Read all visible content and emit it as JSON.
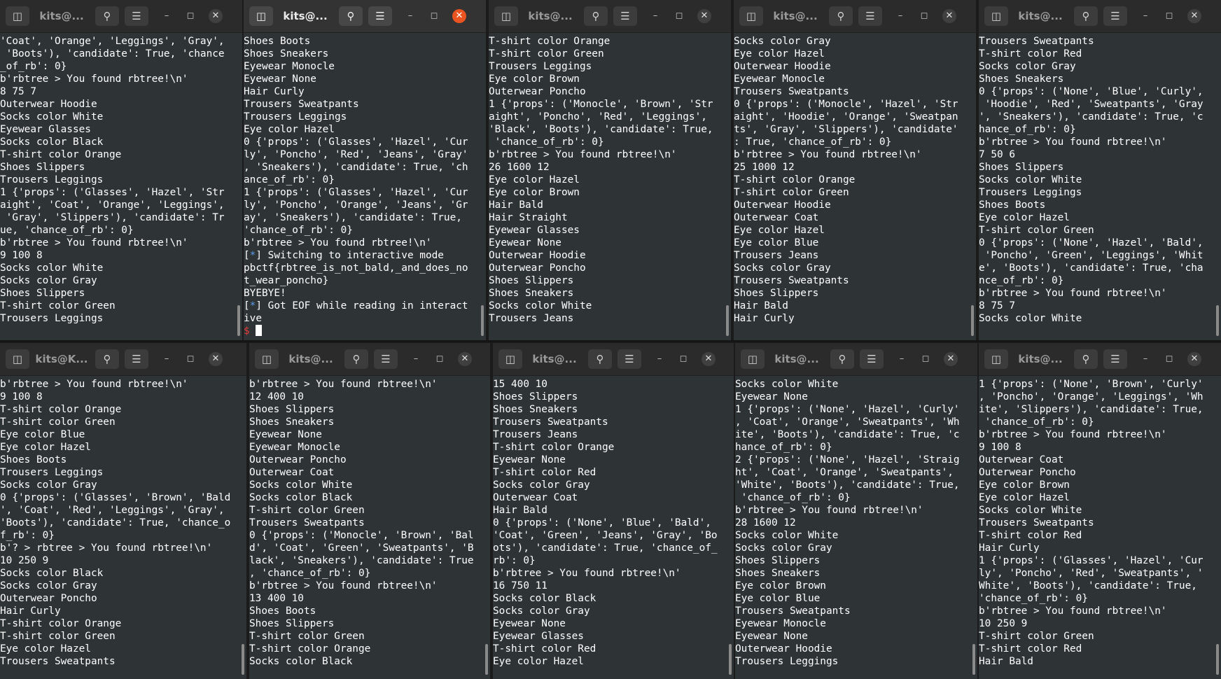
{
  "icons": {
    "new_tab": "new-tab-icon",
    "search": "search-icon",
    "menu": "hamburger-menu-icon",
    "minimize": "minimize-icon",
    "maximize": "maximize-icon",
    "close": "close-icon"
  },
  "colors": {
    "terminal_bg": "#2e3436",
    "close_active": "#e95420",
    "prompt_blue": "#5c9ae6",
    "prompt_red": "#e33b3b"
  },
  "windows": [
    {
      "title": "kits@...",
      "lines": [
        "'Coat', 'Orange', 'Leggings', 'Gray',",
        " 'Boots'), 'candidate': True, 'chance",
        "_of_rb': 0}",
        "b'rbtree > You found rbtree!\\n'",
        "8 75 7",
        "Outerwear Hoodie",
        "Socks color White",
        "Eyewear Glasses",
        "Socks color Black",
        "T-shirt color Orange",
        "Shoes Slippers",
        "Trousers Leggings",
        "1 {'props': ('Glasses', 'Hazel', 'Str",
        "aight', 'Coat', 'Orange', 'Leggings',",
        " 'Gray', 'Slippers'), 'candidate': Tr",
        "ue, 'chance_of_rb': 0}",
        "b'rbtree > You found rbtree!\\n'",
        "9 100 8",
        "Socks color White",
        "Socks color Gray",
        "Shoes Slippers",
        "T-shirt color Green",
        "Trousers Leggings"
      ]
    },
    {
      "title": "kits@...",
      "lines": [
        "Shoes Boots",
        "Shoes Sneakers",
        "Eyewear Monocle",
        "Eyewear None",
        "Hair Curly",
        "Trousers Sweatpants",
        "Trousers Leggings",
        "Eye color Hazel",
        "0 {'props': ('Glasses', 'Hazel', 'Cur",
        "ly', 'Poncho', 'Red', 'Jeans', 'Gray'",
        ", 'Sneakers'), 'candidate': True, 'ch",
        "ance_of_rb': 0}",
        "1 {'props': ('Glasses', 'Hazel', 'Cur",
        "ly', 'Poncho', 'Orange', 'Jeans', 'Gr",
        "ay', 'Sneakers'), 'candidate': True,",
        "'chance_of_rb': 0}",
        "b'rbtree > You found rbtree!\\n'",
        "[*] Switching to interactive mode",
        "pbctf{rbtree_is_not_bald,_and_does_no",
        "t_wear_poncho}",
        "BYEBYE!",
        "[*] Got EOF while reading in interact",
        "ive",
        "$ "
      ]
    },
    {
      "title": "kits@...",
      "lines": [
        "T-shirt color Orange",
        "T-shirt color Green",
        "Trousers Leggings",
        "Eye color Brown",
        "Outerwear Poncho",
        "1 {'props': ('Monocle', 'Brown', 'Str",
        "aight', 'Poncho', 'Red', 'Leggings',",
        "'Black', 'Boots'), 'candidate': True,",
        " 'chance_of_rb': 0}",
        "b'rbtree > You found rbtree!\\n'",
        "26 1600 12",
        "Eye color Hazel",
        "Eye color Brown",
        "Hair Bald",
        "Hair Straight",
        "Eyewear Glasses",
        "Eyewear None",
        "Outerwear Hoodie",
        "Outerwear Poncho",
        "Shoes Slippers",
        "Shoes Sneakers",
        "Socks color White",
        "Trousers Jeans"
      ]
    },
    {
      "title": "kits@...",
      "lines": [
        "Socks color Gray",
        "Eye color Hazel",
        "Outerwear Hoodie",
        "Eyewear Monocle",
        "Trousers Sweatpants",
        "0 {'props': ('Monocle', 'Hazel', 'Str",
        "aight', 'Hoodie', 'Orange', 'Sweatpan",
        "ts', 'Gray', 'Slippers'), 'candidate'",
        ": True, 'chance_of_rb': 0}",
        "b'rbtree > You found rbtree!\\n'",
        "25 1000 12",
        "T-shirt color Orange",
        "T-shirt color Green",
        "Outerwear Hoodie",
        "Outerwear Coat",
        "Eye color Hazel",
        "Eye color Blue",
        "Trousers Jeans",
        "Socks color Gray",
        "Trousers Sweatpants",
        "Shoes Slippers",
        "Hair Bald",
        "Hair Curly"
      ]
    },
    {
      "title": "kits@...",
      "lines": [
        "Trousers Sweatpants",
        "T-shirt color Red",
        "Socks color Gray",
        "Shoes Sneakers",
        "0 {'props': ('None', 'Blue', 'Curly',",
        " 'Hoodie', 'Red', 'Sweatpants', 'Gray",
        "', 'Sneakers'), 'candidate': True, 'c",
        "hance_of_rb': 0}",
        "b'rbtree > You found rbtree!\\n'",
        "7 50 6",
        "Shoes Slippers",
        "Socks color White",
        "Trousers Leggings",
        "Shoes Boots",
        "Eye color Hazel",
        "T-shirt color Green",
        "0 {'props': ('None', 'Hazel', 'Bald',",
        " 'Poncho', 'Green', 'Leggings', 'Whit",
        "e', 'Boots'), 'candidate': True, 'cha",
        "nce_of_rb': 0}",
        "b'rbtree > You found rbtree!\\n'",
        "8 75 7",
        "Socks color White"
      ]
    },
    {
      "title": "kits@K...",
      "lines": [
        "b'rbtree > You found rbtree!\\n'",
        "9 100 8",
        "T-shirt color Orange",
        "T-shirt color Green",
        "Eye color Blue",
        "Eye color Hazel",
        "Shoes Boots",
        "Trousers Leggings",
        "Socks color Gray",
        "0 {'props': ('Glasses', 'Brown', 'Bald",
        "', 'Coat', 'Red', 'Leggings', 'Gray',",
        "'Boots'), 'candidate': True, 'chance_o",
        "f_rb': 0}",
        "b'? > rbtree > You found rbtree!\\n'",
        "10 250 9",
        "Socks color Black",
        "Socks color Gray",
        "Outerwear Poncho",
        "Hair Curly",
        "T-shirt color Orange",
        "T-shirt color Green",
        "Eye color Hazel",
        "Trousers Sweatpants"
      ]
    },
    {
      "title": "kits@...",
      "lines": [
        "b'rbtree > You found rbtree!\\n'",
        "12 400 10",
        "Shoes Slippers",
        "Shoes Sneakers",
        "Eyewear None",
        "Eyewear Monocle",
        "Outerwear Poncho",
        "Outerwear Coat",
        "Socks color White",
        "Socks color Black",
        "T-shirt color Green",
        "Trousers Sweatpants",
        "0 {'props': ('Monocle', 'Brown', 'Bal",
        "d', 'Coat', 'Green', 'Sweatpants', 'B",
        "lack', 'Sneakers'), 'candidate': True",
        ", 'chance_of_rb': 0}",
        "b'rbtree > You found rbtree!\\n'",
        "13 400 10",
        "Shoes Boots",
        "Shoes Slippers",
        "T-shirt color Green",
        "T-shirt color Orange",
        "Socks color Black"
      ]
    },
    {
      "title": "kits@...",
      "lines": [
        "15 400 10",
        "Shoes Slippers",
        "Shoes Sneakers",
        "Trousers Sweatpants",
        "Trousers Jeans",
        "T-shirt color Orange",
        "Eyewear None",
        "T-shirt color Red",
        "Socks color Gray",
        "Outerwear Coat",
        "Hair Bald",
        "0 {'props': ('None', 'Blue', 'Bald',",
        "'Coat', 'Green', 'Jeans', 'Gray', 'Bo",
        "ots'), 'candidate': True, 'chance_of_",
        "rb': 0}",
        "b'rbtree > You found rbtree!\\n'",
        "16 750 11",
        "Socks color Black",
        "Socks color Gray",
        "Eyewear None",
        "Eyewear Glasses",
        "T-shirt color Red",
        "Eye color Hazel"
      ]
    },
    {
      "title": "kits@...",
      "lines": [
        "Socks color White",
        "Eyewear None",
        "1 {'props': ('None', 'Hazel', 'Curly'",
        ", 'Coat', 'Orange', 'Sweatpants', 'Wh",
        "ite', 'Boots'), 'candidate': True, 'c",
        "hance_of_rb': 0}",
        "2 {'props': ('None', 'Hazel', 'Straig",
        "ht', 'Coat', 'Orange', 'Sweatpants',",
        "'White', 'Boots'), 'candidate': True,",
        " 'chance_of_rb': 0}",
        "b'rbtree > You found rbtree!\\n'",
        "28 1600 12",
        "Socks color White",
        "Socks color Gray",
        "Shoes Slippers",
        "Shoes Sneakers",
        "Eye color Brown",
        "Eye color Blue",
        "Trousers Sweatpants",
        "Eyewear Monocle",
        "Eyewear None",
        "Outerwear Hoodie",
        "Trousers Leggings"
      ]
    },
    {
      "title": "kits@...",
      "lines": [
        "1 {'props': ('None', 'Brown', 'Curly'",
        ", 'Poncho', 'Orange', 'Leggings', 'Wh",
        "ite', 'Slippers'), 'candidate': True,",
        " 'chance_of_rb': 0}",
        "b'rbtree > You found rbtree!\\n'",
        "9 100 8",
        "Outerwear Coat",
        "Outerwear Poncho",
        "Eye color Brown",
        "Eye color Hazel",
        "Socks color White",
        "Trousers Sweatpants",
        "T-shirt color Red",
        "Hair Curly",
        "1 {'props': ('Glasses', 'Hazel', 'Cur",
        "ly', 'Poncho', 'Red', 'Sweatpants', '",
        "White', 'Boots'), 'candidate': True,",
        "'chance_of_rb': 0}",
        "b'rbtree > You found rbtree!\\n'",
        "10 250 9",
        "T-shirt color Green",
        "T-shirt color Red",
        "Hair Bald"
      ]
    }
  ]
}
